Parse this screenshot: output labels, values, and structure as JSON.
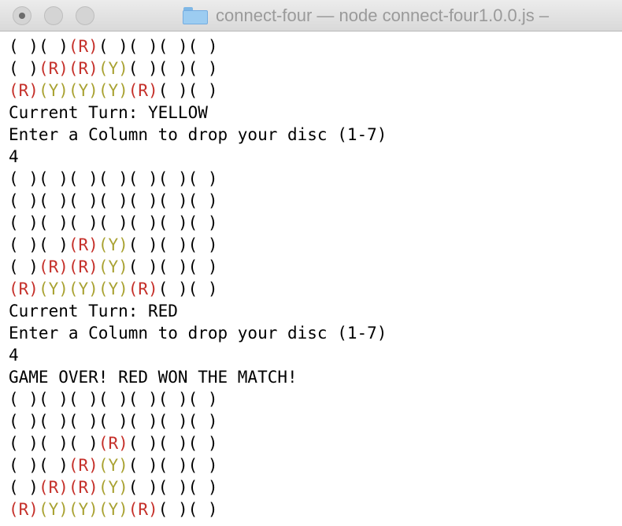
{
  "window": {
    "title": "connect-four — node connect-four1.0.0.js –"
  },
  "colors": {
    "red_disc": "#c5302a",
    "yellow_disc": "#a9a232",
    "text": "#000000"
  },
  "terminal": {
    "lines": [
      {
        "type": "board",
        "cells": [
          "",
          "",
          "R",
          "",
          "",
          "",
          ""
        ]
      },
      {
        "type": "board",
        "cells": [
          "",
          "R",
          "R",
          "Y",
          "",
          "",
          ""
        ]
      },
      {
        "type": "board",
        "cells": [
          "R",
          "Y",
          "Y",
          "Y",
          "R",
          "",
          ""
        ]
      },
      {
        "type": "text",
        "text": "Current Turn: YELLOW"
      },
      {
        "type": "text",
        "text": "Enter a Column to drop your disc (1-7)"
      },
      {
        "type": "text",
        "text": "4"
      },
      {
        "type": "board",
        "cells": [
          "",
          "",
          "",
          "",
          "",
          "",
          ""
        ]
      },
      {
        "type": "board",
        "cells": [
          "",
          "",
          "",
          "",
          "",
          "",
          ""
        ]
      },
      {
        "type": "board",
        "cells": [
          "",
          "",
          "",
          "",
          "",
          "",
          ""
        ]
      },
      {
        "type": "board",
        "cells": [
          "",
          "",
          "R",
          "Y",
          "",
          "",
          ""
        ]
      },
      {
        "type": "board",
        "cells": [
          "",
          "R",
          "R",
          "Y",
          "",
          "",
          ""
        ]
      },
      {
        "type": "board",
        "cells": [
          "R",
          "Y",
          "Y",
          "Y",
          "R",
          "",
          ""
        ]
      },
      {
        "type": "text",
        "text": "Current Turn: RED"
      },
      {
        "type": "text",
        "text": "Enter a Column to drop your disc (1-7)"
      },
      {
        "type": "text",
        "text": "4"
      },
      {
        "type": "text",
        "text": "GAME OVER! RED WON THE MATCH!"
      },
      {
        "type": "board",
        "cells": [
          "",
          "",
          "",
          "",
          "",
          "",
          ""
        ]
      },
      {
        "type": "board",
        "cells": [
          "",
          "",
          "",
          "",
          "",
          "",
          ""
        ]
      },
      {
        "type": "board",
        "cells": [
          "",
          "",
          "",
          "R",
          "",
          "",
          ""
        ]
      },
      {
        "type": "board",
        "cells": [
          "",
          "",
          "R",
          "Y",
          "",
          "",
          ""
        ]
      },
      {
        "type": "board",
        "cells": [
          "",
          "R",
          "R",
          "Y",
          "",
          "",
          ""
        ]
      },
      {
        "type": "board",
        "cells": [
          "R",
          "Y",
          "Y",
          "Y",
          "R",
          "",
          ""
        ]
      }
    ]
  }
}
